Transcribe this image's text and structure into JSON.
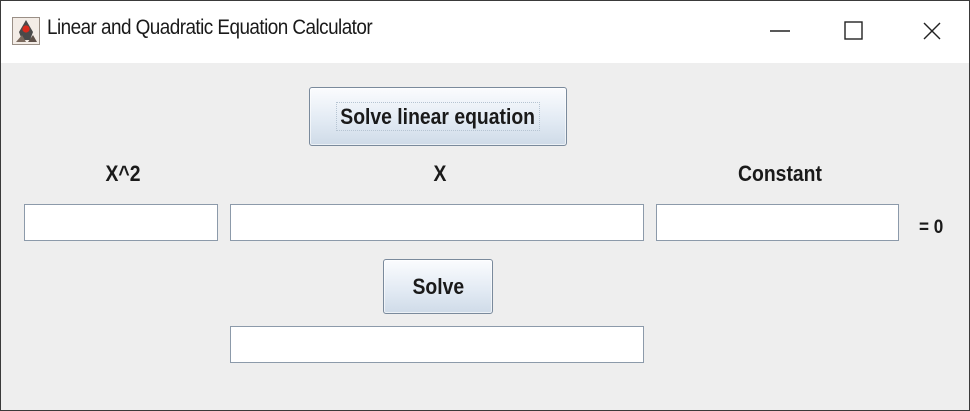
{
  "window": {
    "title": "Linear and Quadratic Equation Calculator",
    "icon": "java-duke-icon",
    "controls": {
      "minimize_icon": "minimize-icon",
      "maximize_icon": "maximize-icon",
      "close_icon": "close-icon"
    }
  },
  "form": {
    "mode_button_label": "Solve linear equation",
    "labels": {
      "x_squared": "X^2",
      "x": "X",
      "constant": "Constant"
    },
    "inputs": {
      "x_squared_value": "",
      "x_value": "",
      "constant_value": ""
    },
    "equals_label": "= 0",
    "solve_button_label": "Solve",
    "result_value": ""
  },
  "colors": {
    "title_bar": "#ffffff",
    "window_bg": "#eeeeee",
    "button_gradient_top": "#fbfcfe",
    "button_gradient_bottom": "#cfdbe8",
    "button_border": "#7a8a9c",
    "field_border": "#8c9aaa"
  }
}
